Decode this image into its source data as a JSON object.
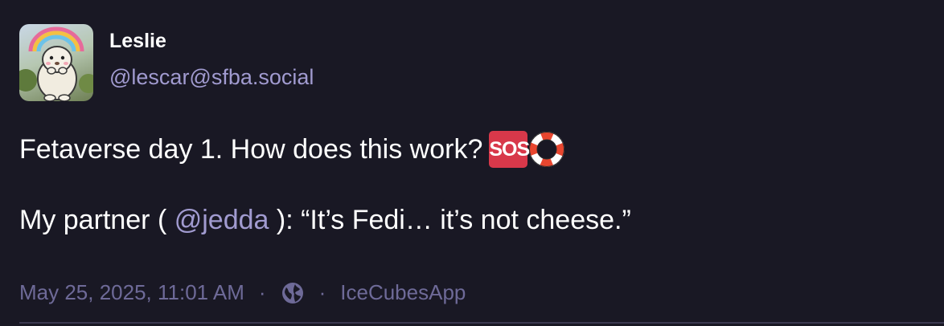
{
  "author": {
    "display_name": "Leslie",
    "handle": "@lescar@sfba.social",
    "avatar_icon": "hedgehog-rainbow-avatar"
  },
  "post": {
    "line1_text": "Fetaverse day 1. How does this work?",
    "sos_label": "SOS",
    "line2_prefix": "My partner (",
    "mention": "@jedda",
    "line2_suffix": "): “It’s Fedi… it’s not cheese.”"
  },
  "meta": {
    "timestamp": "May 25, 2025, 11:01 AM",
    "separator": "·",
    "visibility_icon": "globe-icon",
    "app": "IceCubesApp"
  },
  "colors": {
    "background": "#191824",
    "accent": "#a19bd0",
    "muted": "#6e6a98",
    "sos_red": "#d8384a"
  }
}
